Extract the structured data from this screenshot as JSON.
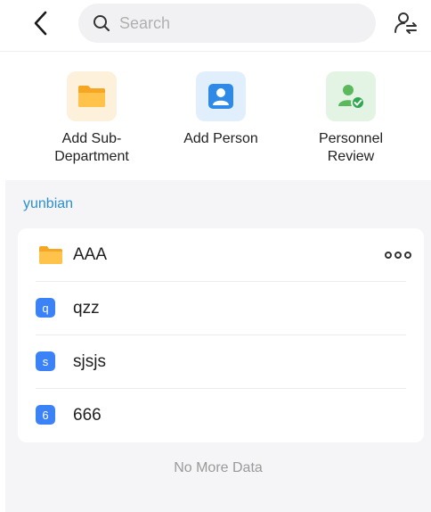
{
  "header": {
    "search_placeholder": "Search"
  },
  "actions": [
    {
      "label": "Add Sub-\nDepartment",
      "icon": "folder-icon",
      "bg": "#fdf1dc"
    },
    {
      "label": "Add Person",
      "icon": "person-icon",
      "bg": "#e0effb"
    },
    {
      "label": "Personnel\nReview",
      "icon": "person-check-icon",
      "bg": "#e4f4e4"
    }
  ],
  "breadcrumb": "yunbian",
  "list": {
    "folder": {
      "name": "AAA"
    },
    "members": [
      {
        "badge": "q",
        "name": "qzz"
      },
      {
        "badge": "s",
        "name": "sjsjs"
      },
      {
        "badge": "6",
        "name": "666"
      }
    ]
  },
  "footer_text": "No More Data",
  "colors": {
    "accent": "#2a8fcf",
    "badge": "#3b82f6",
    "folder": "#f7b733"
  }
}
